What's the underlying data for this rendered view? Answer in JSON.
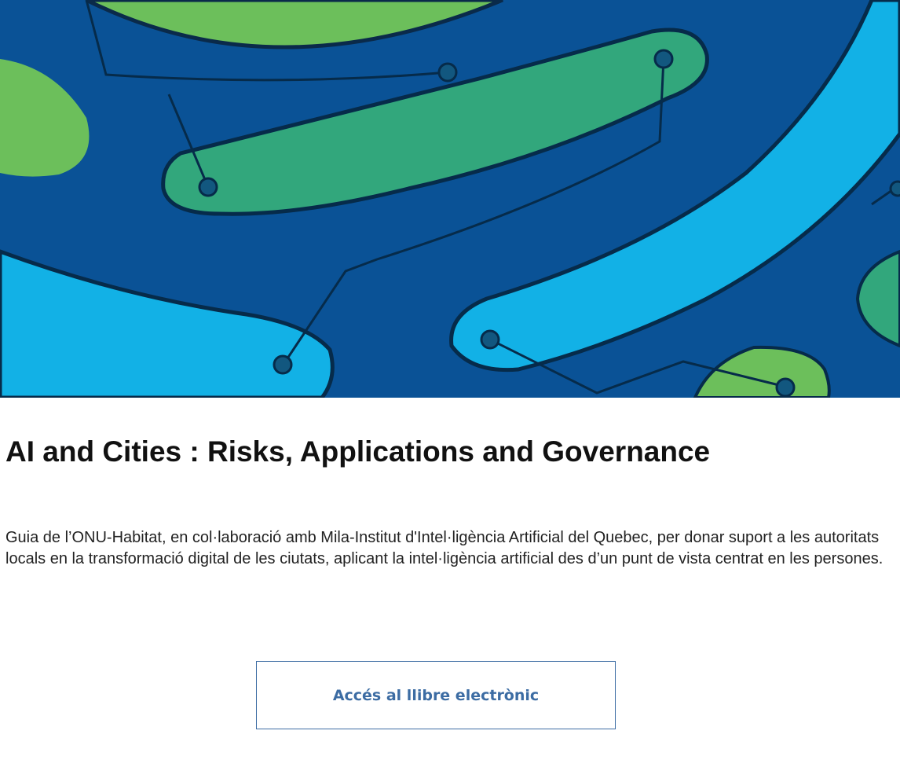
{
  "article": {
    "title": "AI and Cities : Risks, Applications and Governance",
    "description": "Guia de l’ONU-Habitat, en col·laboració amb Mila-Institut d'Intel·ligència Artificial del Quebec, per donar suport a les autoritats locals en la transformació digital de les ciutats, aplicant la intel·ligència artificial des d’un punt de vista centrat en les persones.",
    "cta_label": "Accés al llibre electrònic"
  },
  "colors": {
    "hero_background": "#0a5296",
    "green": "#6cbf5b",
    "teal": "#32a77c",
    "cyan": "#12b1e6",
    "button_border_and_text": "#3c6ca3"
  },
  "icons": {
    "hero_image": "abstract-circuit-pattern-image"
  }
}
